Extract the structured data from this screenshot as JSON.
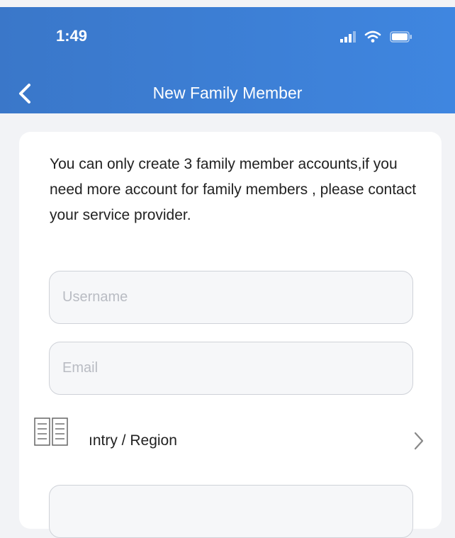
{
  "status_bar": {
    "time": "1:49",
    "icons": [
      "signal-icon",
      "wifi-icon",
      "battery-icon"
    ]
  },
  "nav": {
    "title": "New Family Member",
    "back_icon": "chevron-left-icon"
  },
  "form": {
    "notice": "You can only create 3 family member accounts,if you need more account for family members , please contact your service provider.",
    "username_placeholder": "Username",
    "email_placeholder": "Email",
    "region_label": "ıntry / Region",
    "region_icon": "book-icon",
    "region_chevron": "chevron-right-icon"
  },
  "colors": {
    "header": "#3a7fd6",
    "background": "#f2f3f6",
    "card": "#ffffff"
  }
}
